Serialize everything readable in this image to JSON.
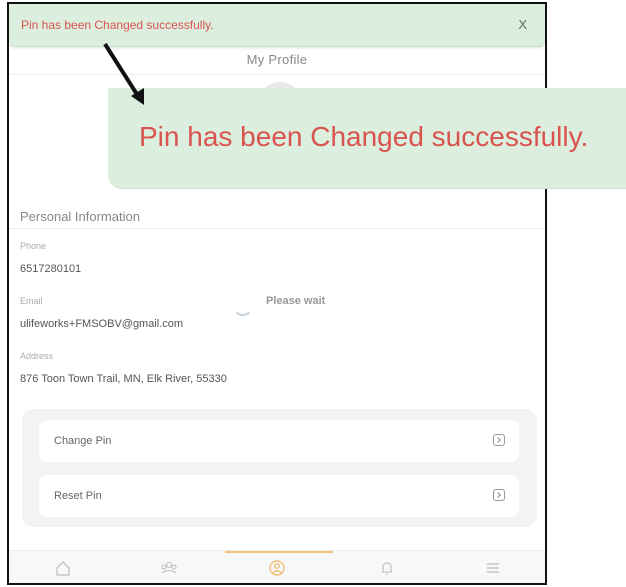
{
  "toast": {
    "message": "Pin has been Changed successfully.",
    "close_label": "X"
  },
  "header": {
    "title": "My Profile"
  },
  "zoom_callout": {
    "message": "Pin has been Changed successfully."
  },
  "personal_info": {
    "section_title": "Personal Information",
    "phone_label": "Phone",
    "phone_value": "6517280101",
    "email_label": "Email",
    "email_value": "ulifeworks+FMSOBV@gmail.com",
    "address_label": "Address",
    "address_value": "876 Toon Town Trail, MN, Elk River, 55330"
  },
  "loading": {
    "text": "Please wait"
  },
  "pin_actions": [
    {
      "label": "Change Pin"
    },
    {
      "label": "Reset Pin"
    }
  ],
  "bottom_nav": {
    "items": [
      "home-icon",
      "community-icon",
      "profile-icon",
      "bell-icon",
      "menu-icon"
    ],
    "active": "profile-icon"
  }
}
